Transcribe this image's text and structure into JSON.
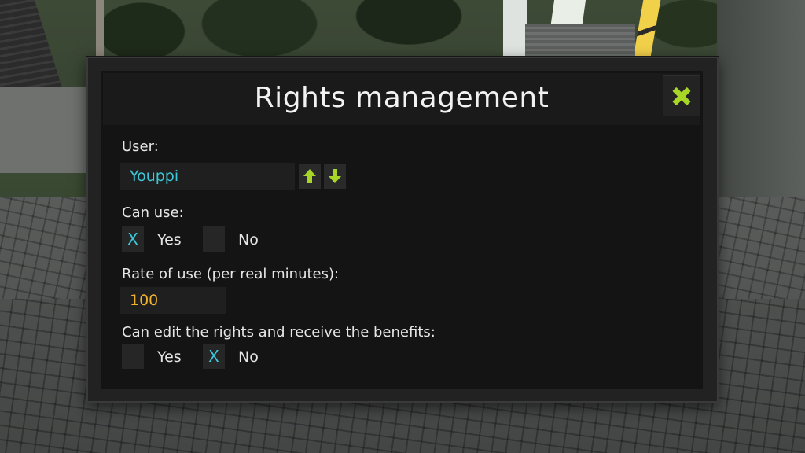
{
  "colors": {
    "accent_green": "#a8d627",
    "value_cyan": "#3cc8d8",
    "value_orange": "#f0b22e"
  },
  "dialog": {
    "title": "Rights management",
    "close_icon": "close-x-icon"
  },
  "user": {
    "label": "User:",
    "value": "Youppi",
    "up_icon": "arrow-up-icon",
    "down_icon": "arrow-down-icon"
  },
  "can_use": {
    "label": "Can use:",
    "yes_label": "Yes",
    "no_label": "No",
    "yes_mark": "X",
    "no_mark": "",
    "selected": "yes"
  },
  "rate": {
    "label": "Rate of use (per real minutes):",
    "value": "100"
  },
  "can_edit": {
    "label": "Can edit the rights and receive the benefits:",
    "yes_label": "Yes",
    "no_label": "No",
    "yes_mark": "",
    "no_mark": "X",
    "selected": "no"
  }
}
